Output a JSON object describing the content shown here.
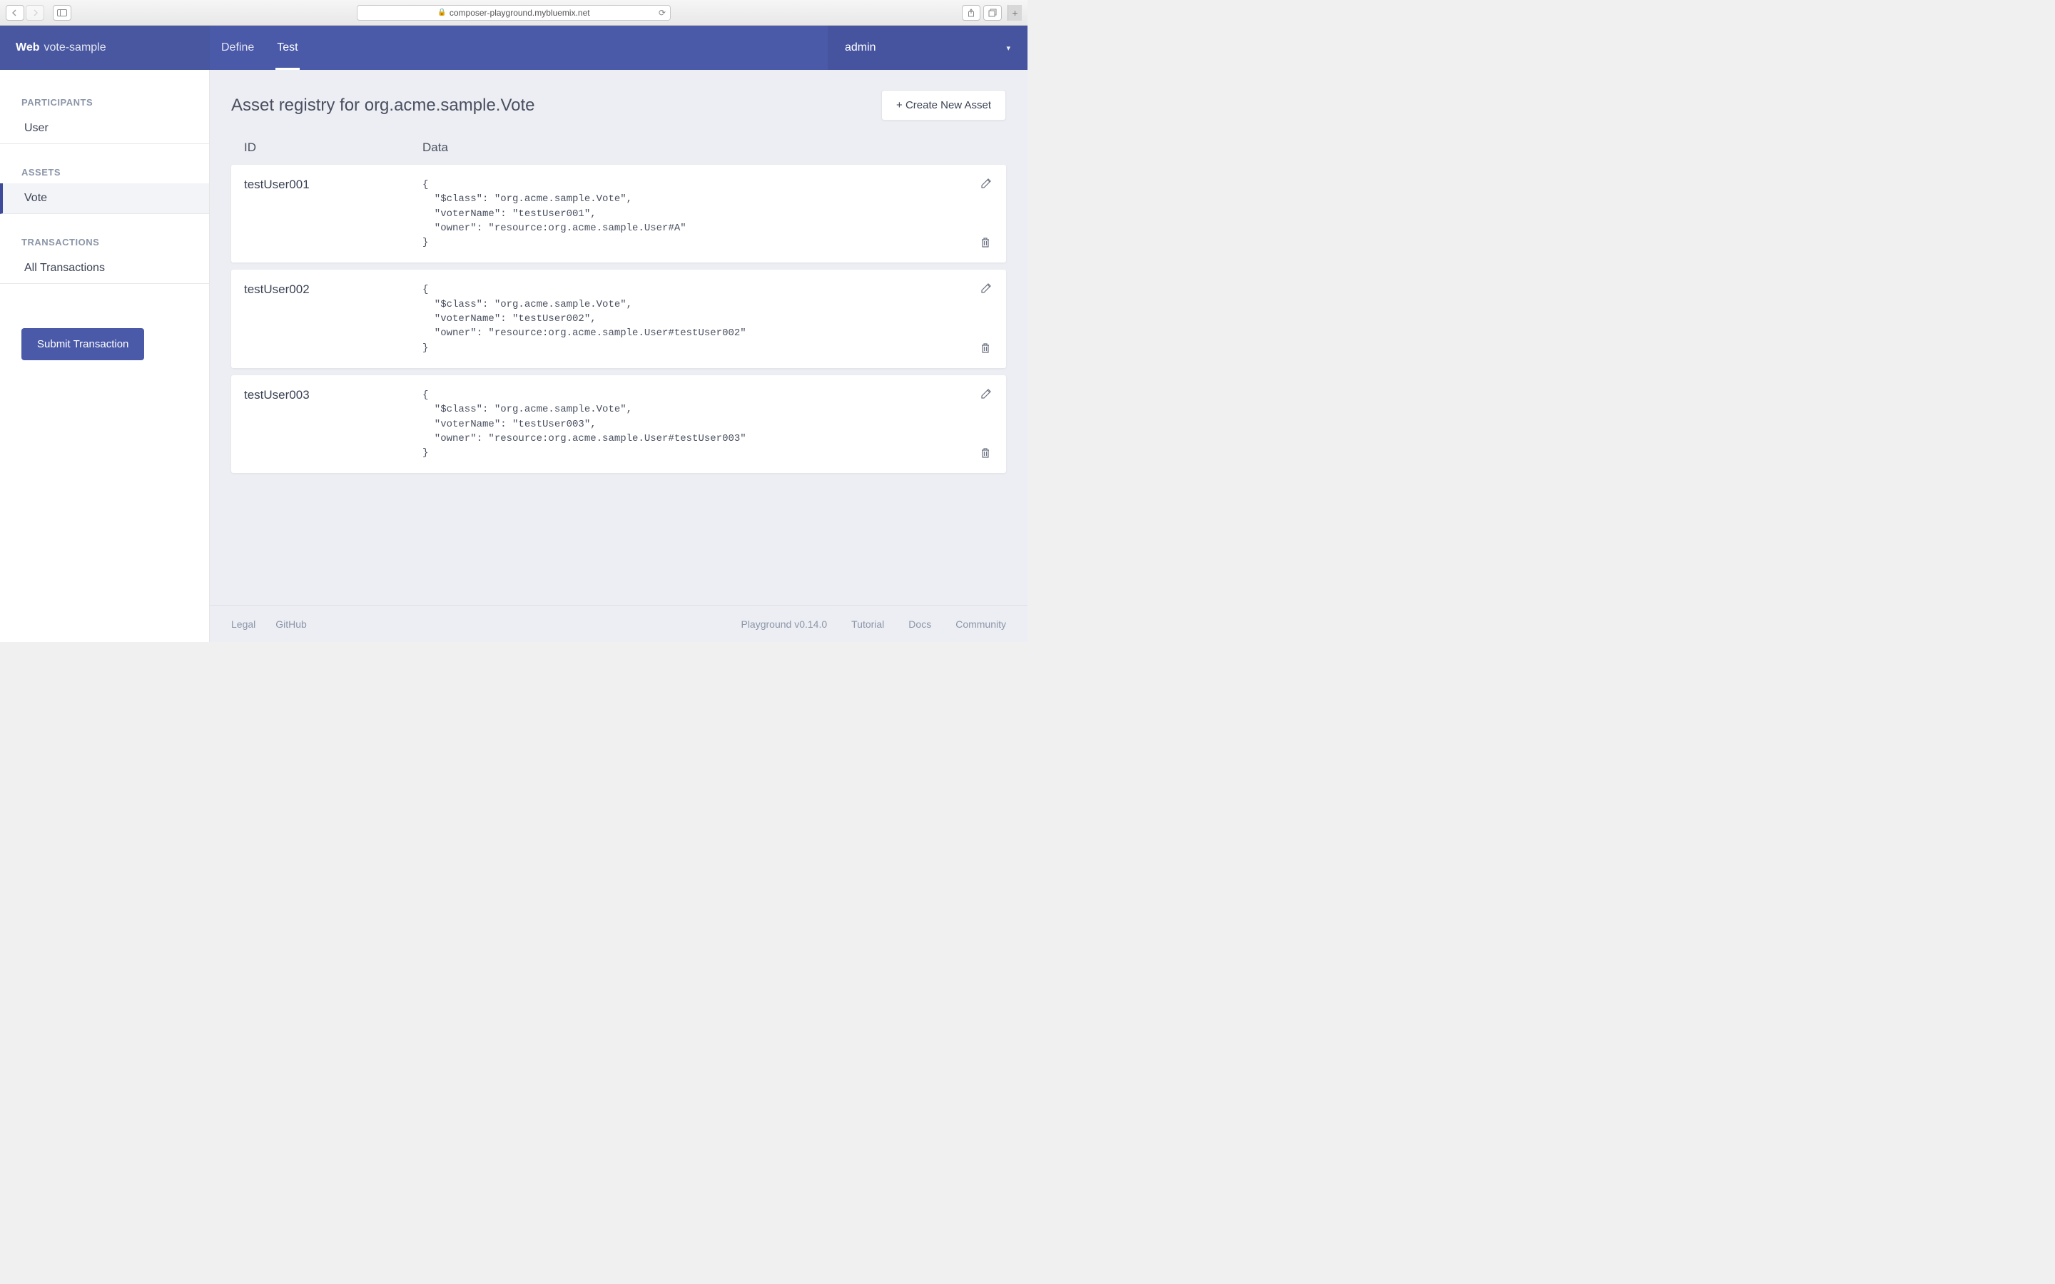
{
  "browser": {
    "url": "composer-playground.mybluemix.net"
  },
  "header": {
    "brand_bold": "Web",
    "brand_name": "vote-sample",
    "tabs": {
      "define": "Define",
      "test": "Test"
    },
    "user": "admin"
  },
  "sidebar": {
    "participants_heading": "PARTICIPANTS",
    "participants": {
      "user": "User"
    },
    "assets_heading": "ASSETS",
    "assets": {
      "vote": "Vote"
    },
    "transactions_heading": "TRANSACTIONS",
    "transactions": {
      "all": "All Transactions"
    },
    "submit_label": "Submit Transaction"
  },
  "content": {
    "title": "Asset registry for org.acme.sample.Vote",
    "create_label": "+ Create New Asset",
    "columns": {
      "id": "ID",
      "data": "Data"
    },
    "rows": [
      {
        "id": "testUser001",
        "data": "{\n  \"$class\": \"org.acme.sample.Vote\",\n  \"voterName\": \"testUser001\",\n  \"owner\": \"resource:org.acme.sample.User#A\"\n}"
      },
      {
        "id": "testUser002",
        "data": "{\n  \"$class\": \"org.acme.sample.Vote\",\n  \"voterName\": \"testUser002\",\n  \"owner\": \"resource:org.acme.sample.User#testUser002\"\n}"
      },
      {
        "id": "testUser003",
        "data": "{\n  \"$class\": \"org.acme.sample.Vote\",\n  \"voterName\": \"testUser003\",\n  \"owner\": \"resource:org.acme.sample.User#testUser003\"\n}"
      }
    ]
  },
  "footer": {
    "legal": "Legal",
    "github": "GitHub",
    "version": "Playground v0.14.0",
    "tutorial": "Tutorial",
    "docs": "Docs",
    "community": "Community"
  }
}
